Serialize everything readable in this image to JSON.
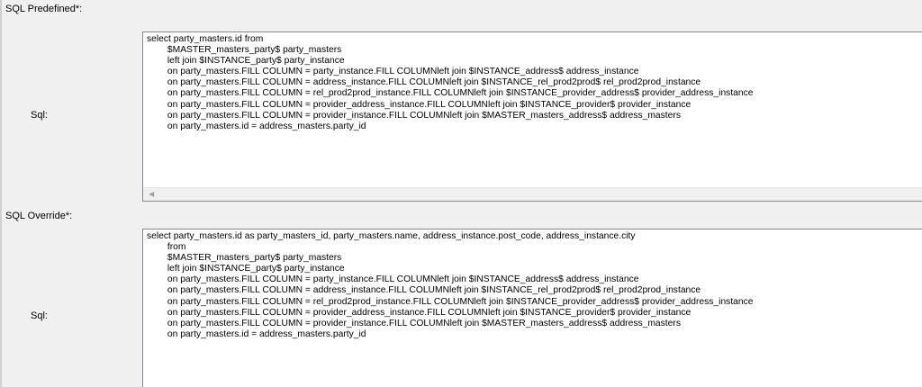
{
  "predefined": {
    "section_title": "SQL Predefined*:",
    "sql_label": "Sql:",
    "sql_text": "select party_masters.id from\n        $MASTER_masters_party$ party_masters\n        left join $INSTANCE_party$ party_instance\n        on party_masters.FILL COLUMN = party_instance.FILL COLUMNleft join $INSTANCE_address$ address_instance\n        on party_masters.FILL COLUMN = address_instance.FILL COLUMNleft join $INSTANCE_rel_prod2prod$ rel_prod2prod_instance\n        on party_masters.FILL COLUMN = rel_prod2prod_instance.FILL COLUMNleft join $INSTANCE_provider_address$ provider_address_instance\n        on party_masters.FILL COLUMN = provider_address_instance.FILL COLUMNleft join $INSTANCE_provider$ provider_instance\n        on party_masters.FILL COLUMN = provider_instance.FILL COLUMNleft join $MASTER_masters_address$ address_masters\n        on party_masters.id = address_masters.party_id",
    "scroll_left_icon": "◀"
  },
  "override": {
    "section_title": "SQL Override*:",
    "sql_label": "Sql:",
    "sql_text": "select party_masters.id as party_masters_id, party_masters.name, address_instance.post_code, address_instance.city\n        from\n        $MASTER_masters_party$ party_masters\n        left join $INSTANCE_party$ party_instance\n        on party_masters.FILL COLUMN = party_instance.FILL COLUMNleft join $INSTANCE_address$ address_instance\n        on party_masters.FILL COLUMN = address_instance.FILL COLUMNleft join $INSTANCE_rel_prod2prod$ rel_prod2prod_instance\n        on party_masters.FILL COLUMN = rel_prod2prod_instance.FILL COLUMNleft join $INSTANCE_provider_address$ provider_address_instance\n        on party_masters.FILL COLUMN = provider_address_instance.FILL COLUMNleft join $INSTANCE_provider$ provider_instance\n        on party_masters.FILL COLUMN = provider_instance.FILL COLUMNleft join $MASTER_masters_address$ address_masters\n        on party_masters.id = address_masters.party_id"
  }
}
